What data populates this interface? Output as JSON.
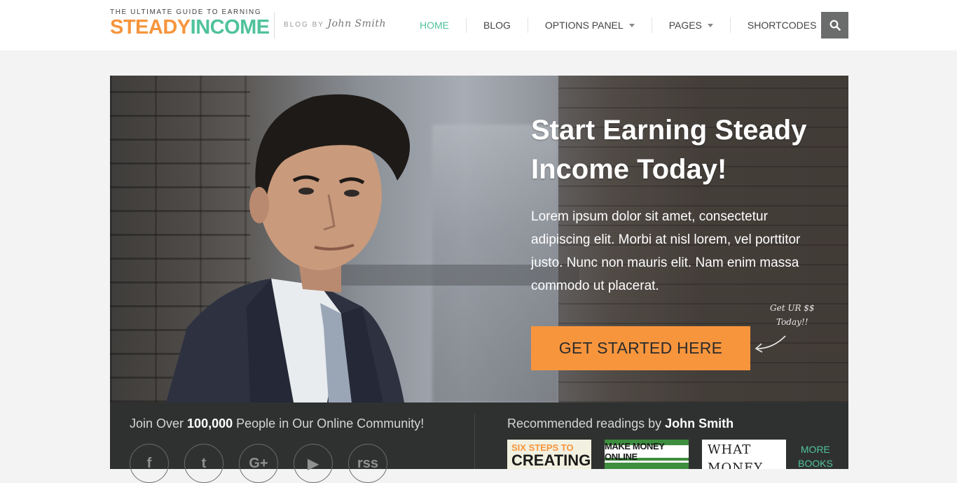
{
  "header": {
    "tagline": "THE ULTIMATE GUIDE TO EARNING",
    "logo_part1": "STEADY",
    "logo_part2": "INCOME",
    "blog_by_prefix": "BLOG BY",
    "blog_by_author": "John Smith",
    "colors": {
      "orange": "#f7953d",
      "green": "#4fc29b"
    }
  },
  "nav": {
    "items": [
      {
        "label": "HOME",
        "active": true
      },
      {
        "label": "BLOG"
      },
      {
        "label": "OPTIONS PANEL",
        "dropdown": true
      },
      {
        "label": "PAGES",
        "dropdown": true
      },
      {
        "label": "SHORTCODES"
      }
    ],
    "search_icon": "search-icon"
  },
  "hero": {
    "title": "Start Earning Steady Income Today!",
    "text": "Lorem ipsum dolor sit amet, consectetur adipiscing elit. Morbi at nisl lorem, vel porttitor justo. Nunc non mauris elit. Nam enim massa commodo ut placerat.",
    "cta": "GET STARTED HERE",
    "note_line1": "Get UR $$",
    "note_line2": "Today!!"
  },
  "community": {
    "prefix": "Join Over",
    "count": "100,000",
    "suffix": "People in Our Online Community!",
    "social_icons": [
      "facebook-icon",
      "twitter-icon",
      "google-plus-icon",
      "youtube-icon",
      "rss-icon"
    ],
    "social_glyphs": [
      "f",
      "t",
      "G+",
      "▶",
      "rss"
    ]
  },
  "readings": {
    "prefix": "Recommended readings by",
    "author": "John Smith",
    "books": [
      {
        "line1": "SIX STEPS TO",
        "line2": "CREATING"
      },
      {
        "line1": "MAKE MONEY ONLINE"
      },
      {
        "line1": "WHAT",
        "line2": "MONEY"
      }
    ],
    "more_line1": "MORE",
    "more_line2": "BOOKS"
  }
}
